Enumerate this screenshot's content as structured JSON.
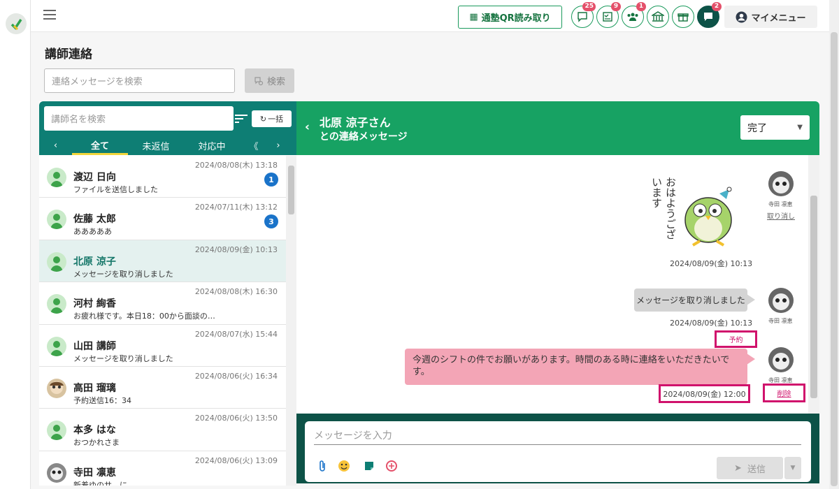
{
  "header": {
    "qr_label": "通塾QR読み取り",
    "icons": [
      {
        "name": "chat-icon",
        "badge": "25"
      },
      {
        "name": "checklist-icon",
        "badge": "9"
      },
      {
        "name": "group-icon",
        "badge": "1"
      },
      {
        "name": "school-icon",
        "badge": ""
      },
      {
        "name": "gift-icon",
        "badge": ""
      },
      {
        "name": "message-icon",
        "badge": "2"
      }
    ],
    "my_menu": "マイメニュー"
  },
  "page": {
    "title": "講師連絡",
    "search_placeholder": "連絡メッセージを検索",
    "search_button": "検索"
  },
  "left": {
    "search_placeholder": "講師名を検索",
    "bulk_button": "一括",
    "tabs": [
      "全て",
      "未返信",
      "対応中",
      "《"
    ],
    "conversations": [
      {
        "name": "渡辺 日向",
        "preview": "ファイルを送信しました",
        "date": "2024/08/08(木) 13:18",
        "unread": "1"
      },
      {
        "name": "佐藤 太郎",
        "preview": "あああああ",
        "date": "2024/07/11(木) 13:12",
        "unread": "3"
      },
      {
        "name": "北原 涼子",
        "preview": "メッセージを取り消しました",
        "date": "2024/08/09(金) 10:13",
        "unread": ""
      },
      {
        "name": "河村 絢香",
        "preview": "お疲れ様です。本日18：00から面談の…",
        "date": "2024/08/08(木) 16:30",
        "unread": ""
      },
      {
        "name": "山田 講師",
        "preview": "メッセージを取り消しました",
        "date": "2024/08/07(水) 15:44",
        "unread": ""
      },
      {
        "name": "高田 瑠璃",
        "preview": "予約送信16：34",
        "date": "2024/08/06(火) 16:34",
        "unread": ""
      },
      {
        "name": "本多 はな",
        "preview": "おつかれさま",
        "date": "2024/08/06(火) 13:50",
        "unread": ""
      },
      {
        "name": "寺田 凛恵",
        "preview": "新着ゆのサ…に",
        "date": "2024/08/06(火) 13:09",
        "unread": ""
      }
    ]
  },
  "right": {
    "title": "北原 涼子さん",
    "subtitle": "との連絡メッセージ",
    "status": "完了",
    "sticker_text": "おはようございます",
    "messages": {
      "sender": "寺田 凛恵",
      "undo": "取り消し",
      "time1": "2024/08/09(金) 10:13",
      "withdrawn": "メッセージを取り消しました",
      "time2": "2024/08/09(金) 10:13",
      "reserved_tag": "予約",
      "pink": "今週のシフトの件でお願いがあります。時間のある時に連絡をいただきたいです。",
      "time3": "2024/08/09(金) 12:00",
      "delete": "削除"
    },
    "input_placeholder": "メッセージを入力",
    "send_button": "送信"
  },
  "colors": {
    "teal": "#0e7e74",
    "green": "#17a263",
    "dark_green": "#0d5247",
    "badge": "#e4506a",
    "pink": "#f3a5b6"
  }
}
